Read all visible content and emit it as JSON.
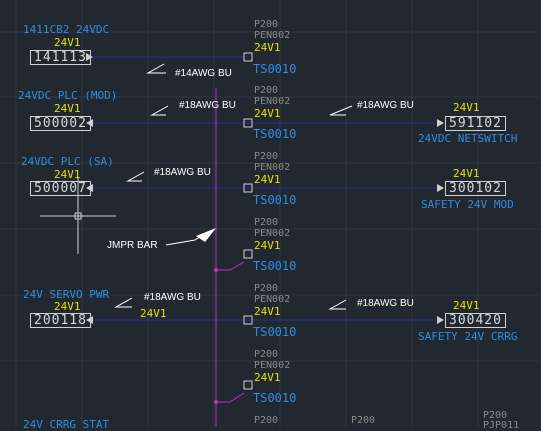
{
  "colors": {
    "background": "#212830",
    "grid": "#2f3640",
    "wire": "#2a2aa8",
    "bus": "#c02cc0",
    "terminal_blue": "#2f8de0",
    "voltage_yellow": "#e6e000",
    "terminal_gray": "#8a8a8a",
    "annotation_white": "#ffffff"
  },
  "left_blocks": [
    {
      "title": "1411CB2 24VDC",
      "voltage": "24V1",
      "box": "141113",
      "arrow": "right"
    },
    {
      "title": "24VDC PLC (MOD)",
      "voltage": "24V1",
      "box": "500002",
      "arrow": "left"
    },
    {
      "title": "24VDC PLC (SA)",
      "voltage": "24V1",
      "box": "500007",
      "arrow": "left"
    },
    {
      "title": "24V SERVO PWR",
      "voltage": "24V1",
      "box": "200118",
      "arrow": "left",
      "voltage_right": "24V1"
    },
    {
      "title": "24V CRRG STAT"
    }
  ],
  "right_blocks": [
    {
      "voltage": "24V1",
      "box": "591102",
      "title": "24VDC NETSWITCH"
    },
    {
      "voltage": "24V1",
      "box": "300102",
      "title": "SAFETY 24V MOD"
    },
    {
      "voltage": "24V1",
      "box": "300420",
      "title": "SAFETY 24V CRRG"
    },
    {
      "top": "P200",
      "bottom": "PJP011"
    }
  ],
  "terminals": [
    {
      "p": "P200",
      "pen": "PEN002",
      "v": "24V1",
      "ts": "TS0010"
    },
    {
      "p": "P200",
      "pen": "PEN002",
      "v": "24V1",
      "ts": "TS0010"
    },
    {
      "p": "P200",
      "pen": "PEN002",
      "v": "24V1",
      "ts": "TS0010"
    },
    {
      "p": "P200",
      "pen": "PEN002",
      "v": "24V1",
      "ts": "TS0010"
    },
    {
      "p": "P200",
      "pen": "PEN002",
      "v": "24V1",
      "ts": "TS0010"
    },
    {
      "p": "P200",
      "pen": "PEN002",
      "v": "24V1",
      "ts": "TS0010"
    },
    {
      "p": "P200"
    }
  ],
  "bottom_center_label": "P200",
  "wire_labels": [
    "#14AWG BU",
    "#18AWG BU",
    "#18AWG BU",
    "#18AWG BU",
    "#18AWG BU",
    "#18AWG BU"
  ],
  "jumper_label": "JMPR BAR"
}
